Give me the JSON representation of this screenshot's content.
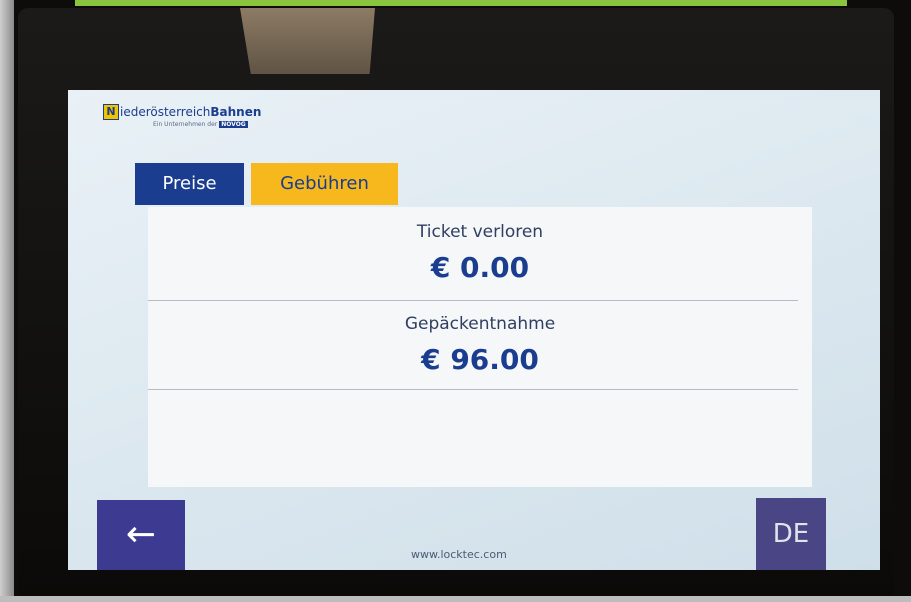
{
  "brand": {
    "logo_letter": "N",
    "name_regular": "iederösterreich",
    "name_bold": "Bahnen",
    "subtitle": "Ein Unternehmen der",
    "parent": "NÖVOG"
  },
  "tabs": [
    {
      "label": "Preise",
      "active": true
    },
    {
      "label": "Gebühren",
      "active": false
    }
  ],
  "fees": [
    {
      "label": "Ticket verloren",
      "price": "€ 0.00"
    },
    {
      "label": "Gepäckentnahme",
      "price": "€ 96.00"
    }
  ],
  "nav": {
    "back_symbol": "←",
    "language": "DE"
  },
  "footer": {
    "url": "www.locktec.com"
  },
  "colors": {
    "primary_blue": "#1a3d8f",
    "accent_yellow": "#f6b81c",
    "button_purple": "#3c3a91"
  }
}
